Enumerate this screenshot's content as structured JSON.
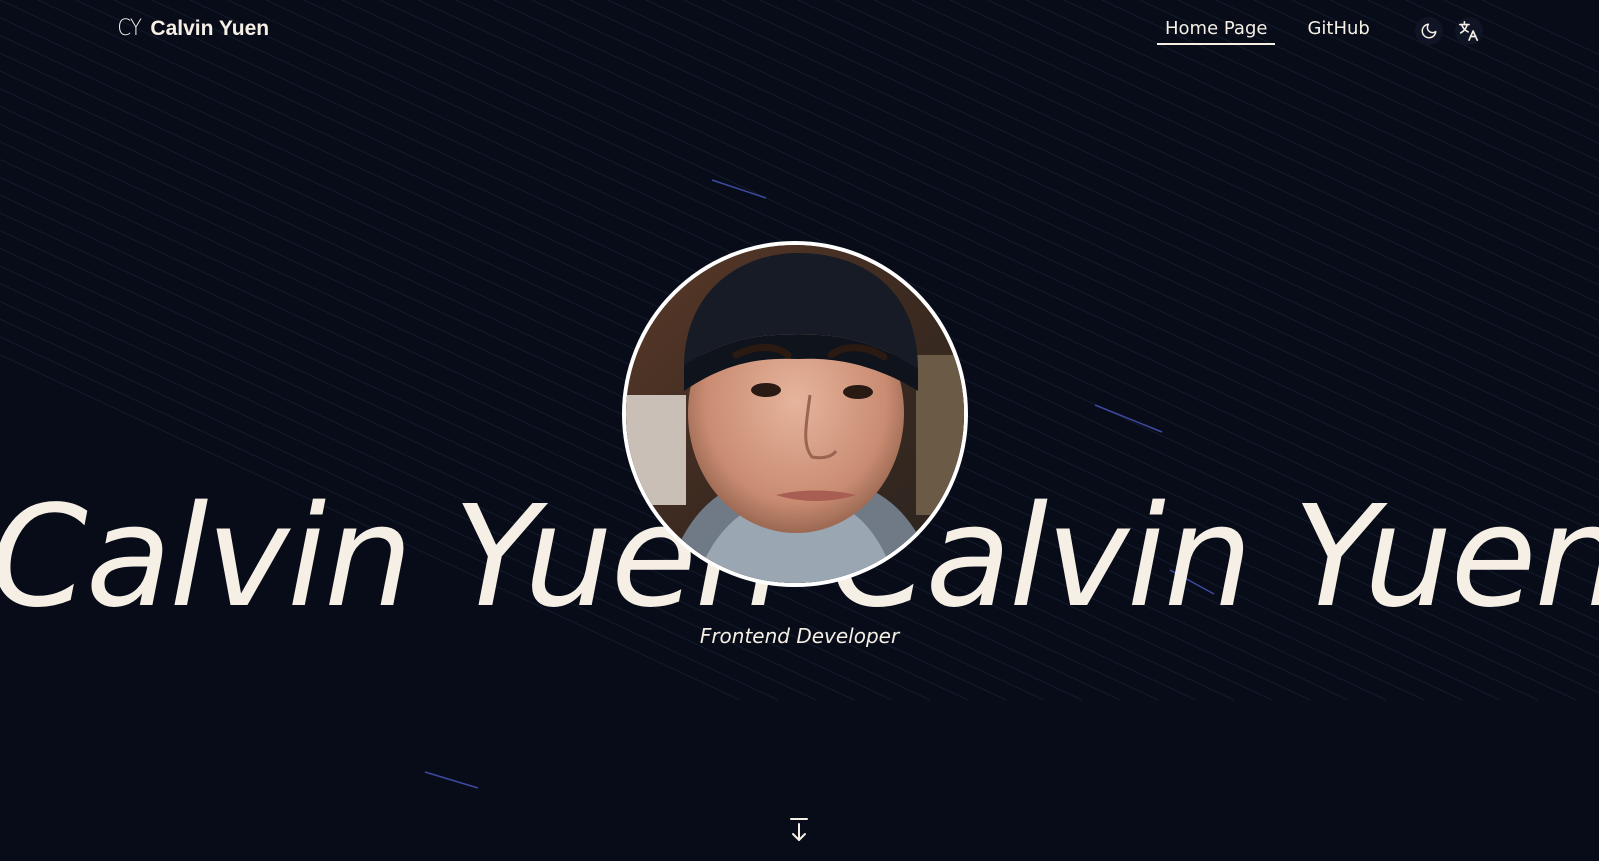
{
  "header": {
    "brand_mark": "CY",
    "brand_name": "Calvin Yuen",
    "nav": [
      {
        "label": "Home Page",
        "active": true
      },
      {
        "label": "GitHub",
        "active": false
      }
    ],
    "theme_icon": "moon-icon",
    "language_icon": "translate-icon"
  },
  "hero": {
    "marquee_text": "Calvin Yuen",
    "subtitle": "Frontend Developer",
    "avatar_icon": "profile-photo",
    "scroll_icon": "arrow-down-to-line-icon"
  },
  "colors": {
    "background": "#070c18",
    "text": "#f5efe6",
    "accent_streak": "#4f5fc9"
  }
}
